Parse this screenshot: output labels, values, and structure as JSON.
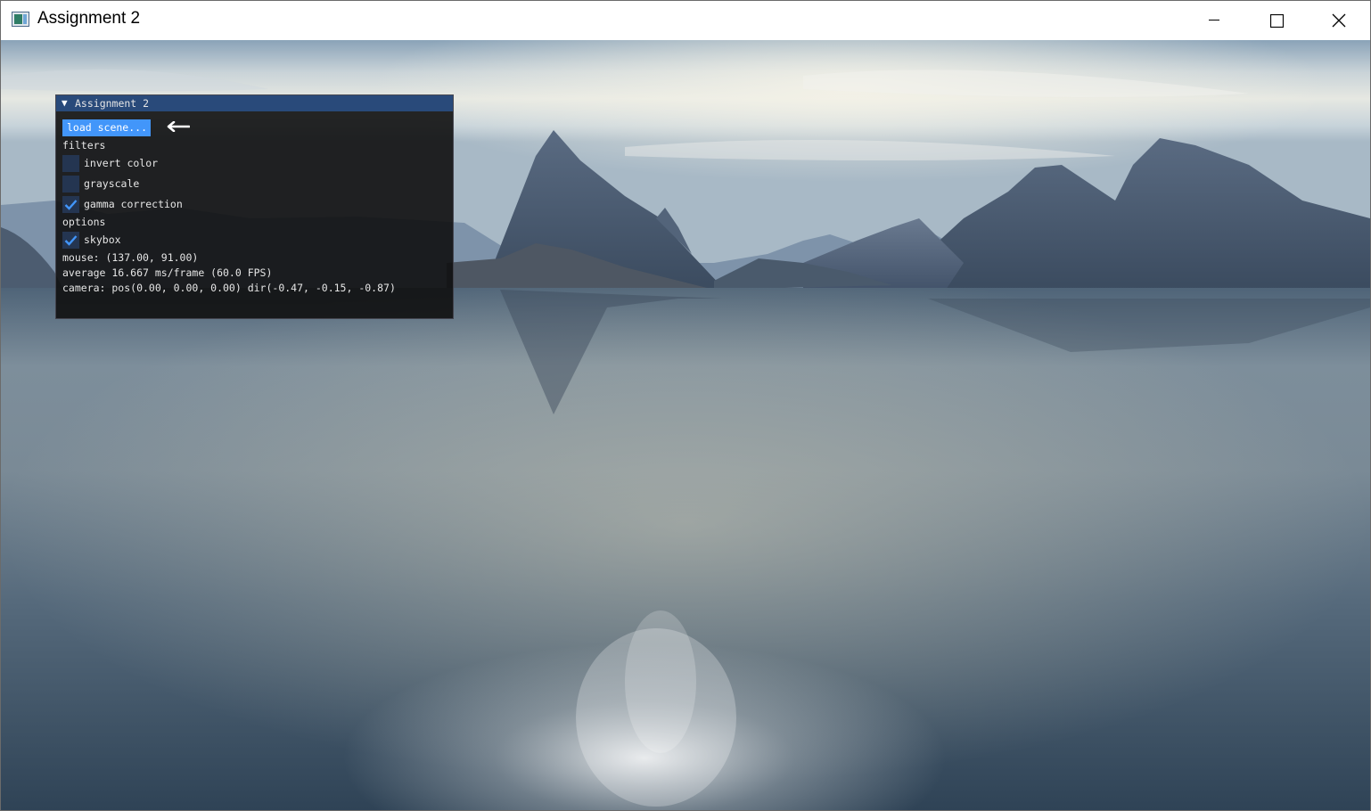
{
  "window": {
    "title": "Assignment 2"
  },
  "panel": {
    "title": "Assignment 2",
    "load_button": "load scene...",
    "filters_heading": "filters",
    "filters": [
      {
        "label": "invert color",
        "checked": false
      },
      {
        "label": "grayscale",
        "checked": false
      },
      {
        "label": "gamma correction",
        "checked": true
      }
    ],
    "options_heading": "options",
    "options": [
      {
        "label": "skybox",
        "checked": true
      }
    ],
    "mouse_text": "mouse: (137.00, 91.00)",
    "fps_text": "average 16.667 ms/frame (60.0 FPS)",
    "camera_text": "camera: pos(0.00, 0.00, 0.00) dir(-0.47, -0.15, -0.87)"
  },
  "colors": {
    "panel_title_bg": "#294a7a",
    "button_bg": "#4296fa",
    "checkbox_bg": "#243551",
    "checkmark": "#4296fa"
  },
  "icons": {
    "window_icon": "app-icon",
    "minimize": "minimize-icon",
    "maximize": "maximize-icon",
    "close": "close-icon",
    "collapse": "triangle-down-icon",
    "pointer": "arrow-left-icon",
    "check": "checkmark-icon"
  }
}
